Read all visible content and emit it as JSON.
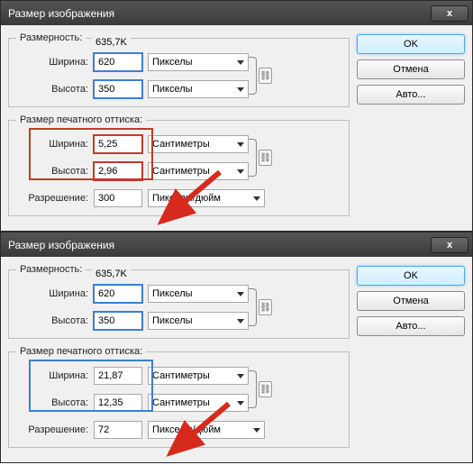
{
  "dialog1": {
    "title": "Размер изображения",
    "close": "x",
    "dim_label": "Размерность:",
    "dim_value": "635,7K",
    "width_label": "Ширина:",
    "height_label": "Высота:",
    "res_label": "Разрешение:",
    "pixel_dims": {
      "width": "620",
      "height": "350",
      "unit": "Пикселы"
    },
    "print_legend": "Размер печатного оттиска:",
    "print_dims": {
      "width": "5,25",
      "height": "2,96",
      "unit": "Сантиметры"
    },
    "resolution": {
      "value": "300",
      "unit": "Пикселы/дюйм"
    },
    "buttons": {
      "ok": "OK",
      "cancel": "Отмена",
      "auto": "Авто..."
    }
  },
  "dialog2": {
    "title": "Размер изображения",
    "close": "x",
    "dim_label": "Размерность:",
    "dim_value": "635,7K",
    "width_label": "Ширина:",
    "height_label": "Высота:",
    "res_label": "Разрешение:",
    "pixel_dims": {
      "width": "620",
      "height": "350",
      "unit": "Пикселы"
    },
    "print_legend": "Размер печатного оттиска:",
    "print_dims": {
      "width": "21,87",
      "height": "12,35",
      "unit": "Сантиметры"
    },
    "resolution": {
      "value": "72",
      "unit": "Пикселы/дюйм"
    },
    "buttons": {
      "ok": "OK",
      "cancel": "Отмена",
      "auto": "Авто..."
    }
  },
  "colors": {
    "accent_blue": "#3b7fd1",
    "accent_red": "#c23a2a",
    "arrow_red": "#d62a1d"
  }
}
